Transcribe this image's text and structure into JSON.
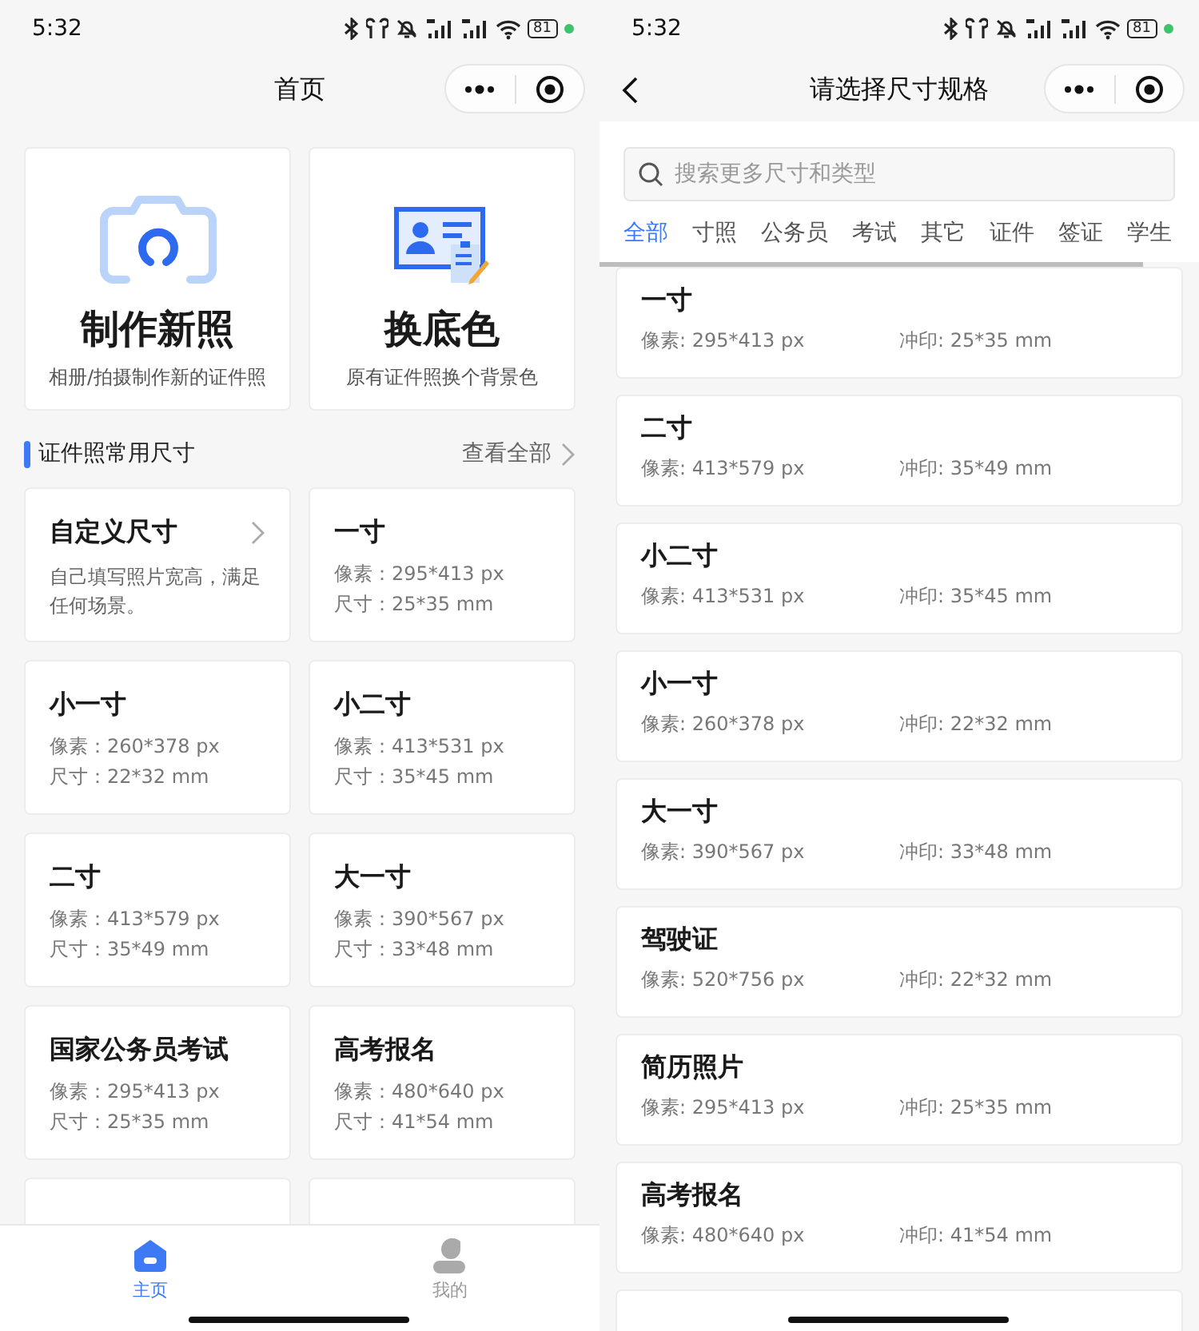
{
  "home_screen": {
    "status_bar": {
      "time": "5:32",
      "battery": "81"
    },
    "title": "首页",
    "features": [
      {
        "kind": "camera",
        "title": "制作新照",
        "subtitle": "相册/拍摄制作新的证件照"
      },
      {
        "kind": "id_card",
        "title": "换底色",
        "subtitle": "原有证件照换个背景色"
      }
    ],
    "section": {
      "title": "证件照常用尺寸",
      "link": "查看全部"
    },
    "size_cards": [
      {
        "kind": "custom",
        "title": "自定义尺寸",
        "description": "自己填写照片宽高，满足任何场景。"
      },
      {
        "kind": "size",
        "title": "一寸",
        "pixels": "像素：295*413 px",
        "size": "尺寸：25*35 mm"
      },
      {
        "kind": "size",
        "title": "小一寸",
        "pixels": "像素：260*378 px",
        "size": "尺寸：22*32 mm"
      },
      {
        "kind": "size",
        "title": "小二寸",
        "pixels": "像素：413*531 px",
        "size": "尺寸：35*45 mm"
      },
      {
        "kind": "size",
        "title": "二寸",
        "pixels": "像素：413*579 px",
        "size": "尺寸：35*49 mm"
      },
      {
        "kind": "size",
        "title": "大一寸",
        "pixels": "像素：390*567 px",
        "size": "尺寸：33*48 mm"
      },
      {
        "kind": "size",
        "title": "国家公务员考试",
        "pixels": "像素：295*413 px",
        "size": "尺寸：25*35 mm"
      },
      {
        "kind": "size",
        "title": "高考报名",
        "pixels": "像素：480*640 px",
        "size": "尺寸：41*54 mm"
      },
      {
        "kind": "partial"
      },
      {
        "kind": "partial"
      }
    ],
    "tab_bar": [
      {
        "kind": "home",
        "label": "主页",
        "selected": true
      },
      {
        "kind": "profile",
        "label": "我的",
        "selected": false
      }
    ]
  },
  "size_list_screen": {
    "status_bar": {
      "time": "5:32",
      "battery": "81"
    },
    "title": "请选择尺寸规格",
    "search": {
      "placeholder": "搜索更多尺寸和类型"
    },
    "tabs": [
      {
        "label": "全部",
        "selected": true
      },
      {
        "label": "寸照",
        "selected": false
      },
      {
        "label": "公务员",
        "selected": false
      },
      {
        "label": "考试",
        "selected": false
      },
      {
        "label": "其它",
        "selected": false
      },
      {
        "label": "证件",
        "selected": false
      },
      {
        "label": "签证",
        "selected": false
      },
      {
        "label": "学生",
        "selected": false
      }
    ],
    "items": [
      {
        "title": "一寸",
        "pixels": "像素: 295*413 px",
        "print": "冲印: 25*35 mm"
      },
      {
        "title": "二寸",
        "pixels": "像素: 413*579 px",
        "print": "冲印: 35*49 mm"
      },
      {
        "title": "小二寸",
        "pixels": "像素: 413*531 px",
        "print": "冲印: 35*45 mm"
      },
      {
        "title": "小一寸",
        "pixels": "像素: 260*378 px",
        "print": "冲印: 22*32 mm"
      },
      {
        "title": "大一寸",
        "pixels": "像素: 390*567 px",
        "print": "冲印: 33*48 mm"
      },
      {
        "title": "驾驶证",
        "pixels": "像素: 520*756 px",
        "print": "冲印: 22*32 mm"
      },
      {
        "title": "简历照片",
        "pixels": "像素: 295*413 px",
        "print": "冲印: 25*35 mm"
      },
      {
        "title": "高考报名",
        "pixels": "像素: 480*640 px",
        "print": "冲印: 41*54 mm"
      }
    ]
  }
}
